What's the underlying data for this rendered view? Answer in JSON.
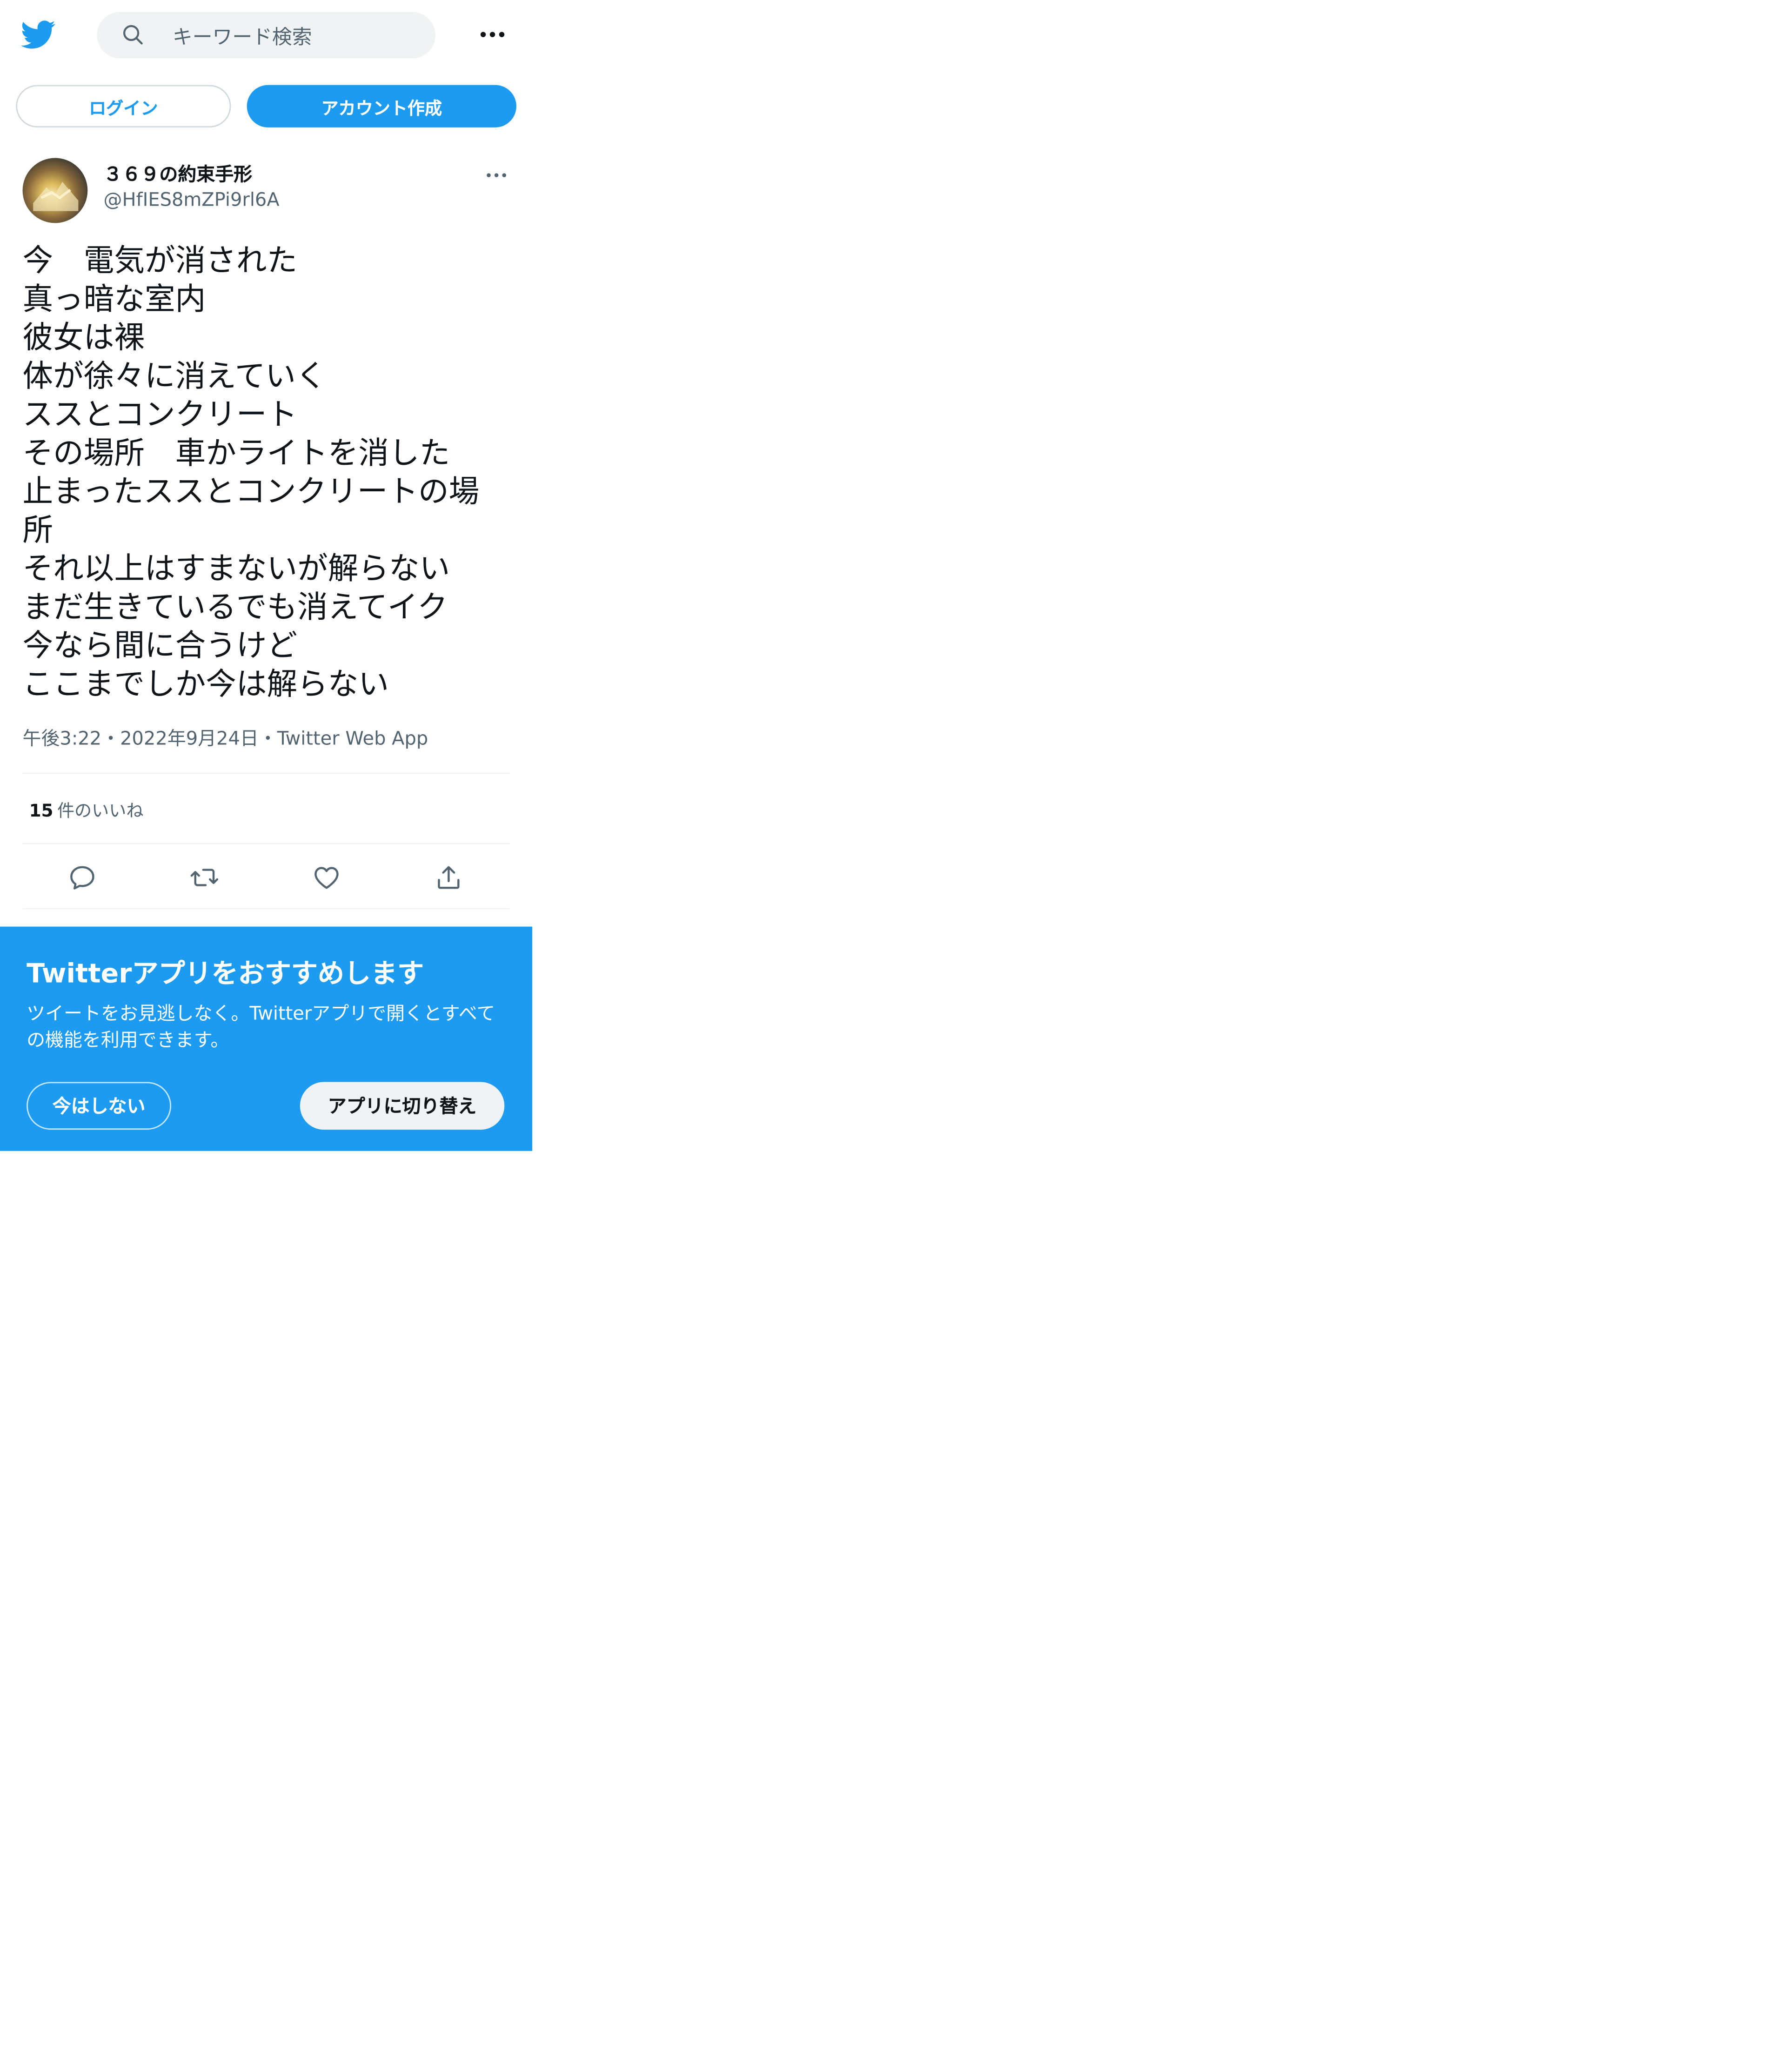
{
  "header": {
    "logo_icon": "twitter-bird-icon",
    "search": {
      "icon": "search-icon",
      "placeholder": "キーワード検索"
    },
    "more_icon": "more-horizontal-icon"
  },
  "auth": {
    "login_label": "ログイン",
    "signup_label": "アカウント作成"
  },
  "tweet": {
    "author": {
      "name": "３６９の約束手形",
      "handle": "@HfIES8mZPi9rl6A",
      "avatar_icon": "avatar-image"
    },
    "lines": [
      "今　電気が消された",
      "真っ暗な室内",
      "彼女は裸",
      "体が徐々に消えていく",
      "ススとコンクリート",
      "その場所　車かライトを消した",
      "止まったススとコンクリートの場",
      "所",
      "それ以上はすまないが解らない",
      "まだ生きているでも消えてイク",
      "今なら間に合うけど",
      "ここまでしか今は解らない"
    ],
    "time": "午後3:22",
    "date": "2022年9月24日",
    "source": "Twitter Web App",
    "separator": "・",
    "likes_count": "15",
    "likes_label": "件のいいね",
    "actions": [
      "reply-icon",
      "retweet-icon",
      "like-icon",
      "share-icon"
    ]
  },
  "banner": {
    "title": "Twitterアプリをおすすめします",
    "description": "ツイートをお見逃しなく。Twitterアプリで開くとすべての機能を利用できます。",
    "not_now_label": "今はしない",
    "switch_label": "アプリに切り替え"
  },
  "colors": {
    "brand": "#1d9bf0",
    "text": "#0f1419",
    "secondary": "#536471",
    "divider": "#eff3f4"
  }
}
